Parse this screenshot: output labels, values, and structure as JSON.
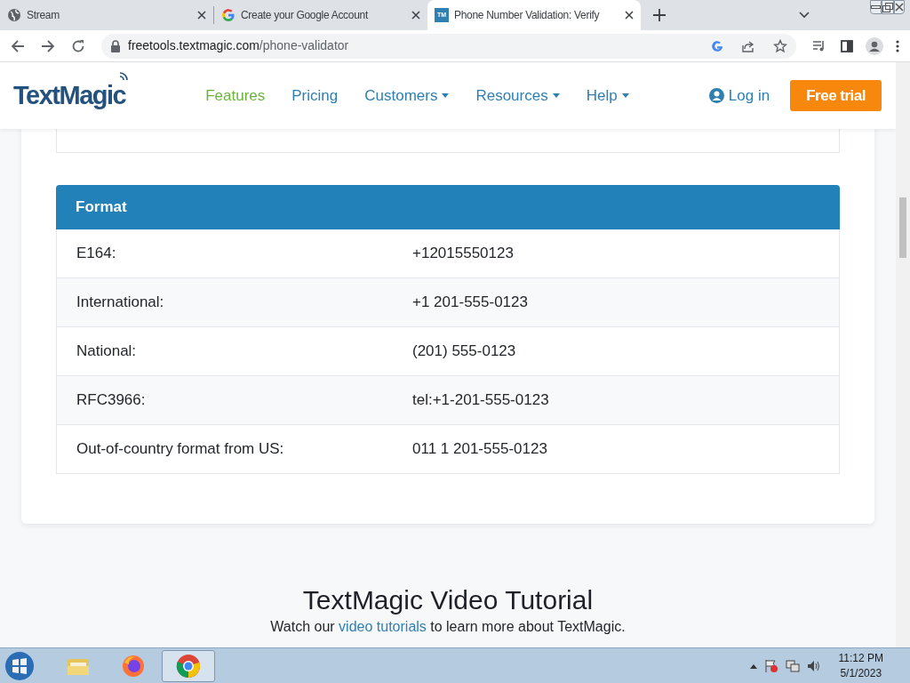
{
  "browser": {
    "tabs": [
      {
        "title": "Stream",
        "selected": false
      },
      {
        "title": "Create your Google Account",
        "selected": false
      },
      {
        "title": "Phone Number Validation: Verify",
        "selected": true
      }
    ],
    "tm_icon_text": "TM",
    "address": {
      "host": "freetools.textmagic.com",
      "path": "/phone-validator"
    }
  },
  "header": {
    "logo": "TextMagic",
    "nav": [
      {
        "label": "Features",
        "selected": true,
        "dropdown": false
      },
      {
        "label": "Pricing",
        "selected": false,
        "dropdown": false
      },
      {
        "label": "Customers",
        "selected": false,
        "dropdown": true
      },
      {
        "label": "Resources",
        "selected": false,
        "dropdown": true
      },
      {
        "label": "Help",
        "selected": false,
        "dropdown": true
      }
    ],
    "login": "Log in",
    "cta": "Free trial"
  },
  "format_table": {
    "title": "Format",
    "rows": [
      {
        "label": "E164:",
        "value": "+12015550123"
      },
      {
        "label": "International:",
        "value": "+1 201-555-0123"
      },
      {
        "label": "National:",
        "value": "(201) 555-0123"
      },
      {
        "label": "RFC3966:",
        "value": "tel:+1-201-555-0123"
      },
      {
        "label": "Out-of-country format from US:",
        "value": "011 1 201-555-0123"
      }
    ]
  },
  "tutorial": {
    "title": "TextMagic Video Tutorial",
    "text": "Watch our ",
    "link": "video tutorials",
    "text_after": " to learn more about TextMagic."
  },
  "taskbar": {
    "apps": [
      {
        "kind": "folder",
        "selected": false
      },
      {
        "kind": "firefox",
        "selected": false
      },
      {
        "kind": "chrome",
        "selected": true
      }
    ],
    "time": "11:12 PM",
    "date": "5/1/2023"
  }
}
